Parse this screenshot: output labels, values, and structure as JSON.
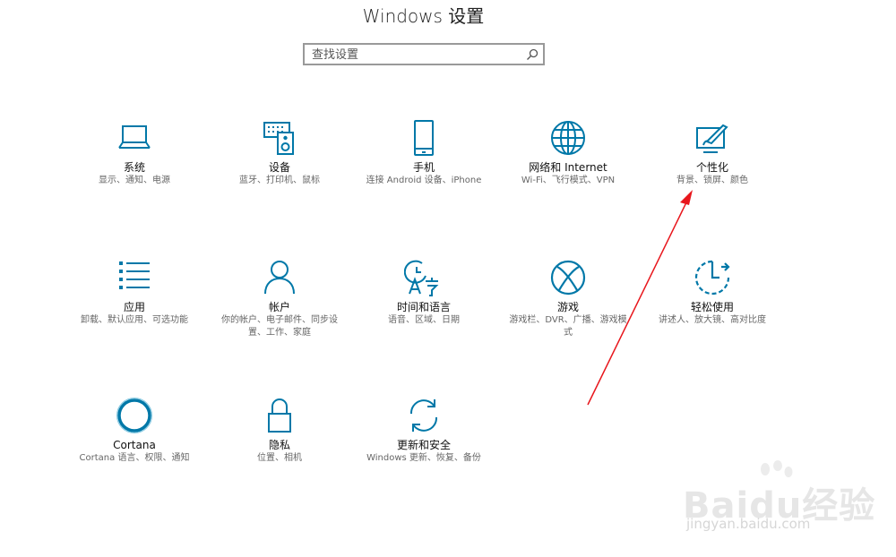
{
  "header": {
    "title": "Windows 设置"
  },
  "search": {
    "placeholder": "查找设置"
  },
  "tiles": [
    {
      "name": "系统",
      "desc": "显示、通知、电源",
      "icon": "laptop-icon"
    },
    {
      "name": "设备",
      "desc": "蓝牙、打印机、鼠标",
      "icon": "keyboard-speaker-icon"
    },
    {
      "name": "手机",
      "desc": "连接 Android 设备、iPhone",
      "icon": "phone-icon"
    },
    {
      "name": "网络和 Internet",
      "desc": "Wi-Fi、飞行模式、VPN",
      "icon": "globe-icon"
    },
    {
      "name": "个性化",
      "desc": "背景、锁屏、颜色",
      "icon": "paint-brush-icon"
    },
    {
      "name": "应用",
      "desc": "卸载、默认应用、可选功能",
      "icon": "apps-list-icon"
    },
    {
      "name": "帐户",
      "desc": "你的帐户、电子邮件、同步设置、工作、家庭",
      "icon": "person-icon"
    },
    {
      "name": "时间和语言",
      "desc": "语音、区域、日期",
      "icon": "time-language-icon"
    },
    {
      "name": "游戏",
      "desc": "游戏栏、DVR、广播、游戏模式",
      "icon": "xbox-icon"
    },
    {
      "name": "轻松使用",
      "desc": "讲述人、放大镜、高对比度",
      "icon": "ease-of-access-icon"
    },
    {
      "name": "Cortana",
      "desc": "Cortana 语言、权限、通知",
      "icon": "cortana-icon"
    },
    {
      "name": "隐私",
      "desc": "位置、相机",
      "icon": "lock-icon"
    },
    {
      "name": "更新和安全",
      "desc": "Windows 更新、恢复、备份",
      "icon": "sync-icon"
    }
  ],
  "watermark": {
    "brand": "Baidu经验",
    "url": "jingyan.baidu.com"
  },
  "annotation": {
    "arrow_color": "#e8161c"
  },
  "colors": {
    "accent": "#0078a8",
    "text": "#111111",
    "subtext": "#666666"
  }
}
